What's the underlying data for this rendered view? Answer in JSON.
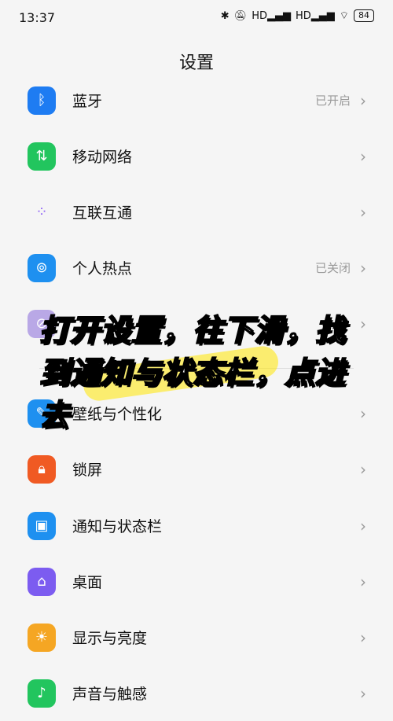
{
  "status_bar": {
    "time": "13:37",
    "icons": [
      "bluetooth-icon",
      "mute-icon",
      "signal-hd-icon",
      "signal-hd-icon",
      "wifi-icon"
    ],
    "battery": "84"
  },
  "page": {
    "title": "设置"
  },
  "items": [
    {
      "label": "蓝牙",
      "value": "已开启",
      "icon": "bluetooth-icon",
      "color": "#1e7cf2"
    },
    {
      "label": "移动网络",
      "value": "",
      "icon": "mobile-data-icon",
      "color": "#22c55e"
    },
    {
      "label": "互联互通",
      "value": "",
      "icon": "dots-icon",
      "color": "#ffffff"
    },
    {
      "label": "个人热点",
      "value": "已关闭",
      "icon": "hotspot-icon",
      "color": "#1e90f0"
    },
    {
      "label": "",
      "value": "",
      "icon": "vpn-icon",
      "color": "#b9a8e6"
    },
    {
      "label": "壁纸与个性化",
      "value": "",
      "icon": "brush-icon",
      "color": "#1e90f0"
    },
    {
      "label": "锁屏",
      "value": "",
      "icon": "lock-icon",
      "color": "#f05a23"
    },
    {
      "label": "通知与状态栏",
      "value": "",
      "icon": "notification-icon",
      "color": "#1e90f0"
    },
    {
      "label": "桌面",
      "value": "",
      "icon": "home-icon",
      "color": "#7c5cf0"
    },
    {
      "label": "显示与亮度",
      "value": "",
      "icon": "brightness-icon",
      "color": "#f5a623"
    },
    {
      "label": "声音与触感",
      "value": "",
      "icon": "sound-icon",
      "color": "#22c55e"
    }
  ],
  "overlay_text": {
    "line1": "打开设置，往下滑，找",
    "line2": "到通知与状态栏，点进",
    "line3": "去"
  }
}
